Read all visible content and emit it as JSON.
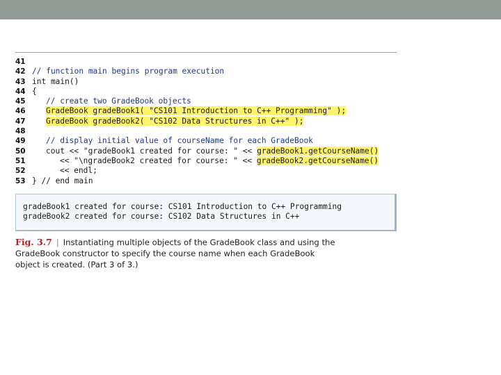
{
  "code": {
    "lines": [
      {
        "num": "41",
        "text": ""
      },
      {
        "num": "42",
        "text": "// function main begins program execution"
      },
      {
        "num": "43",
        "text": "int main()"
      },
      {
        "num": "44",
        "text": "{"
      },
      {
        "num": "45",
        "text": "// create two GradeBook objects"
      },
      {
        "num": "46",
        "text": "GradeBook gradeBook1( \"CS101 Introduction to C++ Programming\" );"
      },
      {
        "num": "47",
        "text": "GradeBook gradeBook2( \"CS102 Data Structures in C++\" );"
      },
      {
        "num": "48",
        "text": ""
      },
      {
        "num": "49",
        "text": "// display initial value of courseName for each GradeBook"
      },
      {
        "num": "50",
        "text_pre": "cout << \"gradeBook1 created for course: \" << ",
        "text_hl": "gradeBook1.getCourseName()"
      },
      {
        "num": "51",
        "text_pre": "<< \"\\ngradeBook2 created for course: \" << ",
        "text_hl": "gradeBook2.getCourseName()"
      },
      {
        "num": "52",
        "text": "<< endl;"
      },
      {
        "num": "53",
        "text": "} // end main"
      }
    ]
  },
  "output": {
    "lines": [
      "gradeBook1 created for course: CS101 Introduction to C++ Programming",
      "gradeBook2 created for course: CS102 Data Structures in C++"
    ]
  },
  "caption": {
    "label": "Fig. 3.7",
    "separator": "|",
    "text": "Instantiating multiple objects of the GradeBook class and using the GradeBook constructor to specify the course name when each GradeBook object is created. (Part 3 of 3.)"
  },
  "colors": {
    "top_bar": "#929b95",
    "highlight": "#fff36a",
    "figure_label": "#b22222"
  }
}
